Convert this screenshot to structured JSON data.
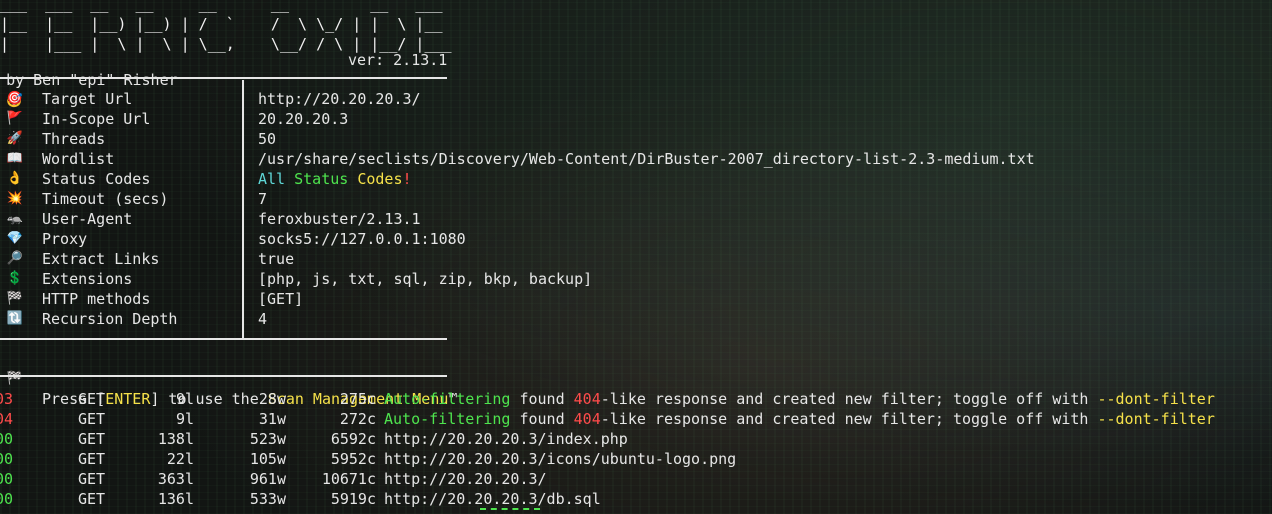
{
  "banner": {
    "art_lines": [
      "___  ___  __   __     __      __         __   ___",
      "|__  |__  |__) |__) | /  `    /  \\ \\_/ | |  \\ |__",
      "|    |___ |  \\ |  \\ | \\__,    \\__/ / \\ | |__/ |___"
    ],
    "author": "by Ben \"epi\" Risher",
    "author_emoji": "🤓",
    "version": "ver: 2.13.1"
  },
  "config": [
    {
      "emoji": "🎯",
      "label": "Target Url",
      "value": "http://20.20.20.3/"
    },
    {
      "emoji": "🚩",
      "label": "In-Scope Url",
      "value": "20.20.20.3"
    },
    {
      "emoji": "🚀",
      "label": "Threads",
      "value": "50"
    },
    {
      "emoji": "📖",
      "label": "Wordlist",
      "value": "/usr/share/seclists/Discovery/Web-Content/DirBuster-2007_directory-list-2.3-medium.txt"
    },
    {
      "emoji": "👌",
      "label": "Status Codes",
      "value_parts": [
        "All",
        "Status",
        "Codes",
        "!"
      ]
    },
    {
      "emoji": "💥",
      "label": "Timeout (secs)",
      "value": "7"
    },
    {
      "emoji": "🦡",
      "label": "User-Agent",
      "value": "feroxbuster/2.13.1"
    },
    {
      "emoji": "💎",
      "label": "Proxy",
      "value": "socks5://127.0.0.1:1080"
    },
    {
      "emoji": "🔎",
      "label": "Extract Links",
      "value": "true"
    },
    {
      "emoji": "💲",
      "label": "Extensions",
      "value": "[php, js, txt, sql, zip, bkp, backup]"
    },
    {
      "emoji": "🏁",
      "label": "HTTP methods",
      "value": "[GET]"
    },
    {
      "emoji": "🔃",
      "label": "Recursion Depth",
      "value": "4"
    }
  ],
  "press": {
    "emoji": "🏁",
    "prefix": "Press [",
    "key": "ENTER",
    "middle": "] to use the ",
    "menu": "Scan Management Menu",
    "tm": "™"
  },
  "results": [
    {
      "status": "403",
      "method": "GET",
      "lines": "9l",
      "words": "28w",
      "chars": "275c",
      "msg": {
        "auto": "Auto-filtering",
        "found": " found ",
        "code": "404",
        "rest": "-like response and created new filter; toggle off with ",
        "flag": "--dont-filter"
      }
    },
    {
      "status": "404",
      "method": "GET",
      "lines": "9l",
      "words": "31w",
      "chars": "272c",
      "msg": {
        "auto": "Auto-filtering",
        "found": " found ",
        "code": "404",
        "rest": "-like response and created new filter; toggle off with ",
        "flag": "--dont-filter"
      }
    },
    {
      "status": "200",
      "method": "GET",
      "lines": "138l",
      "words": "523w",
      "chars": "6592c",
      "url": "http://20.20.20.3/index.php"
    },
    {
      "status": "200",
      "method": "GET",
      "lines": "22l",
      "words": "105w",
      "chars": "5952c",
      "url": "http://20.20.20.3/icons/ubuntu-logo.png"
    },
    {
      "status": "200",
      "method": "GET",
      "lines": "363l",
      "words": "961w",
      "chars": "10671c",
      "url": "http://20.20.20.3/"
    },
    {
      "status": "200",
      "method": "GET",
      "lines": "136l",
      "words": "533w",
      "chars": "5919c",
      "url": "http://20.20.20.3/db.sql"
    }
  ],
  "colors": {
    "status_403": "#ff4b4b",
    "status_404": "#ff4b4b",
    "status_200": "#4ee44e",
    "accent_yellow": "#f5e14a",
    "accent_cyan": "#5fd7d7"
  }
}
